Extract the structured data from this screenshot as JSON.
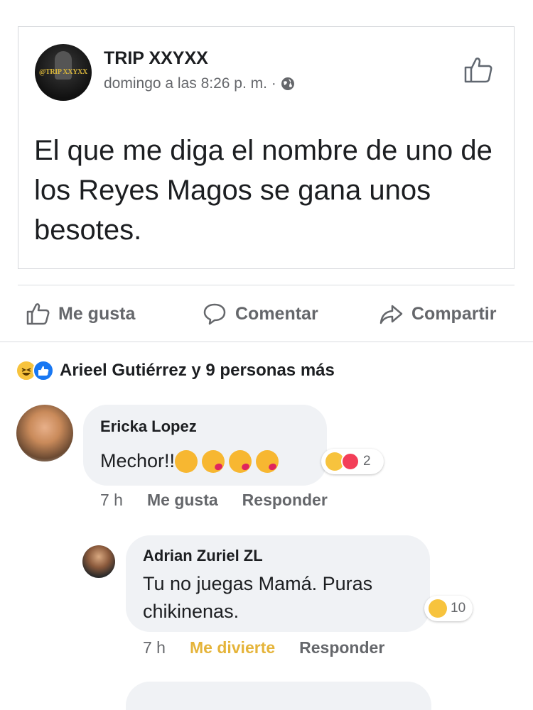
{
  "post": {
    "page_name": "TRIP XXYXX",
    "page_logo_text": "@TRIP XXYXX",
    "timestamp": "domingo a las 8:26 p. m. ·",
    "text": "El que me diga el nombre de uno de los Reyes Magos se gana unos besotes."
  },
  "actions": {
    "like": "Me gusta",
    "comment": "Comentar",
    "share": "Compartir"
  },
  "reactions_summary": {
    "text": "Arieel Gutiérrez y 9 personas más",
    "icons": [
      "haha-icon",
      "like-icon"
    ]
  },
  "comments": [
    {
      "author": "Ericka Lopez",
      "text": "Mechor!!",
      "emojis": [
        "kissing-face-icon",
        "face-blowing-kiss-icon",
        "face-blowing-kiss-icon",
        "face-blowing-kiss-icon"
      ],
      "reaction_count": "2",
      "time": "7 h",
      "like_label": "Me gusta",
      "reply_label": "Responder"
    },
    {
      "author": "Adrian Zuriel ZL",
      "text_line1": "Tu no juegas Mamá. Puras",
      "text_line2": "chikinenas.",
      "reaction_count": "10",
      "time": "7 h",
      "reaction_label": "Me divierte",
      "reply_label": "Responder"
    }
  ],
  "colors": {
    "brand_blue": "#1877f2",
    "haha_yellow": "#f7c33d",
    "love_red": "#f33e58",
    "secondary_text": "#65676b",
    "bubble_bg": "#f0f2f5"
  }
}
